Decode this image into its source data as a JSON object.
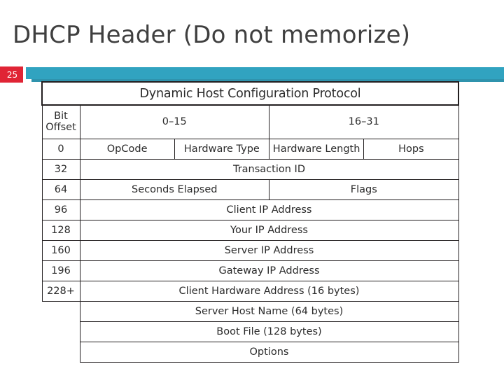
{
  "slide": {
    "title": "DHCP Header (Do not memorize)",
    "number": "25",
    "accent_color": "#31a3c0",
    "badge_color": "#e02435",
    "title_color": "#3f3f3f"
  },
  "packet_table": {
    "protocol_title": "Dynamic Host Configuration Protocol",
    "offset_header": {
      "line1": "Bit",
      "line2": "Offset"
    },
    "bit_ranges": [
      "0–15",
      "16–31"
    ],
    "rows": [
      {
        "offset": "0",
        "fields": [
          "OpCode",
          "Hardware Type",
          "Hardware Length",
          "Hops"
        ]
      },
      {
        "offset": "32",
        "fields": [
          "Transaction ID"
        ]
      },
      {
        "offset": "64",
        "fields": [
          "Seconds Elapsed",
          "Flags"
        ]
      },
      {
        "offset": "96",
        "fields": [
          "Client IP Address"
        ]
      },
      {
        "offset": "128",
        "fields": [
          "Your IP Address"
        ]
      },
      {
        "offset": "160",
        "fields": [
          "Server IP Address"
        ]
      },
      {
        "offset": "196",
        "fields": [
          "Gateway IP Address"
        ]
      },
      {
        "offset": "228+",
        "fields": [
          "Client Hardware Address (16 bytes)"
        ]
      },
      {
        "offset": "",
        "fields": [
          "Server Host Name (64 bytes)"
        ]
      },
      {
        "offset": "",
        "fields": [
          "Boot File (128 bytes)"
        ]
      },
      {
        "offset": "",
        "fields": [
          "Options"
        ]
      }
    ]
  }
}
